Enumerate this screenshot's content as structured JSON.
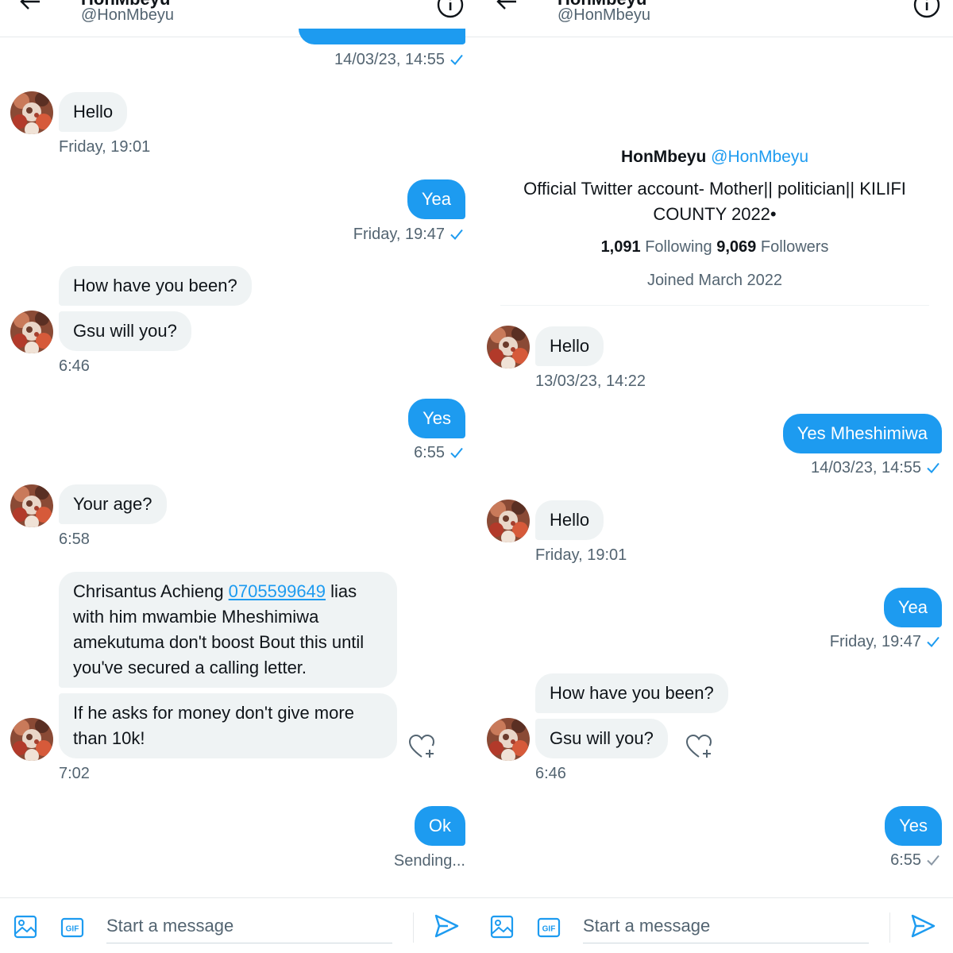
{
  "colors": {
    "accent": "#1d9bf0",
    "bubble_in": "#eff3f4",
    "muted": "#536471"
  },
  "header": {
    "name": "HonMbeyu",
    "handle": "@HonMbeyu"
  },
  "composer": {
    "placeholder": "Start a message"
  },
  "left": {
    "top_time": "14/03/23, 14:55",
    "m1": "Hello",
    "m1_time": "Friday, 19:01",
    "m2": "Yea",
    "m2_time": "Friday, 19:47",
    "m3": "How have you been?",
    "m4": "Gsu will you?",
    "m4_time": "6:46",
    "m5": "Yes",
    "m5_time": "6:55",
    "m6": "Your age?",
    "m6_time": "6:58",
    "m7_pre": "Chrisantus Achieng ",
    "m7_phone": "0705599649",
    "m7_post": "lias with him mwambie Mheshimiwa amekutuma don't boost Bout this until you've secured a calling letter.",
    "m8": "If he asks for money don't give more than 10k!",
    "m8_time": "7:02",
    "m9": "Ok",
    "m9_status": "Sending..."
  },
  "right": {
    "profile_name": "HonMbeyu",
    "profile_handle": "@HonMbeyu",
    "bio": "Official Twitter account- Mother|| politician||  KILIFI COUNTY  2022•",
    "following_count": "1,091",
    "following_label": "Following",
    "followers_count": "9,069",
    "followers_label": "Followers",
    "joined": "Joined March 2022",
    "m1": "Hello",
    "m1_time": "13/03/23, 14:22",
    "m2": "Yes Mheshimiwa",
    "m2_time": "14/03/23, 14:55",
    "m3": "Hello",
    "m3_time": "Friday, 19:01",
    "m4": "Yea",
    "m4_time": "Friday, 19:47",
    "m5": "How have you been?",
    "m6": "Gsu will you?",
    "m6_time": "6:46",
    "m7": "Yes",
    "m7_time": "6:55"
  }
}
